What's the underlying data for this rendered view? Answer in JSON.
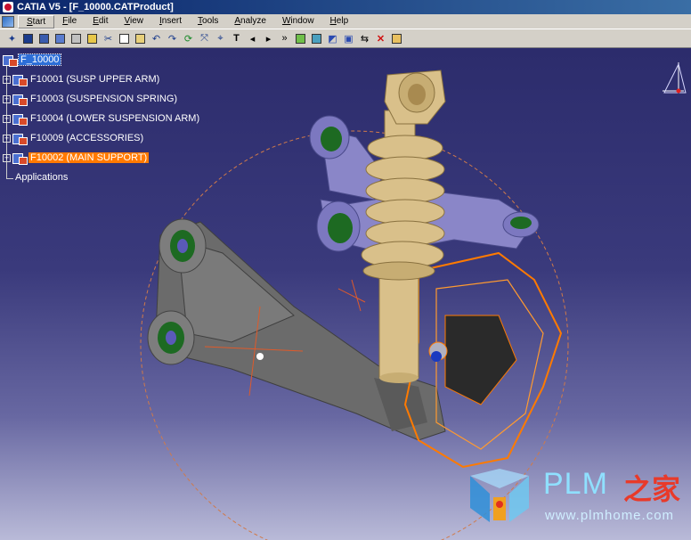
{
  "window": {
    "title": "CATIA V5 - [F_10000.CATProduct]"
  },
  "menu": [
    "Start",
    "File",
    "Edit",
    "View",
    "Insert",
    "Tools",
    "Analyze",
    "Window",
    "Help"
  ],
  "toolbar": {
    "icons": [
      "new-icon",
      "save-icon",
      "save-all-icon",
      "save-mgmt-icon",
      "print-icon",
      "open-icon",
      "cut-icon",
      "copy-icon",
      "paste-icon",
      "undo-icon",
      "redo-icon",
      "update-icon",
      "fly-icon",
      "zoom-icon",
      "text-icon",
      "arrow-left-icon",
      "arrow-right-icon",
      "arrow-double-icon",
      "normal-view-icon",
      "multi-view-icon",
      "shading-icon",
      "hide-icon",
      "swap-icon",
      "delete-icon",
      "clipboard-icon"
    ]
  },
  "tree": {
    "root": "F_10000",
    "children": [
      "F10001 (SUSP UPPER ARM)",
      "F10003 (SUSPENSION SPRING)",
      "F10004 (LOWER SUSPENSION ARM)",
      "F10009 (ACCESSORIES)",
      "F10002 (MAIN SUPPORT)"
    ],
    "applications": "Applications"
  },
  "watermark": {
    "brand": "PLM",
    "brand_cn": "之家",
    "url": "www.plmhome.com"
  },
  "colors": {
    "selection": "#2d6fd8",
    "highlight": "#ff7a00",
    "part_gray": "#6b6b6b",
    "spring": "#d9c08a",
    "upper_arm": "#8a86c8"
  }
}
